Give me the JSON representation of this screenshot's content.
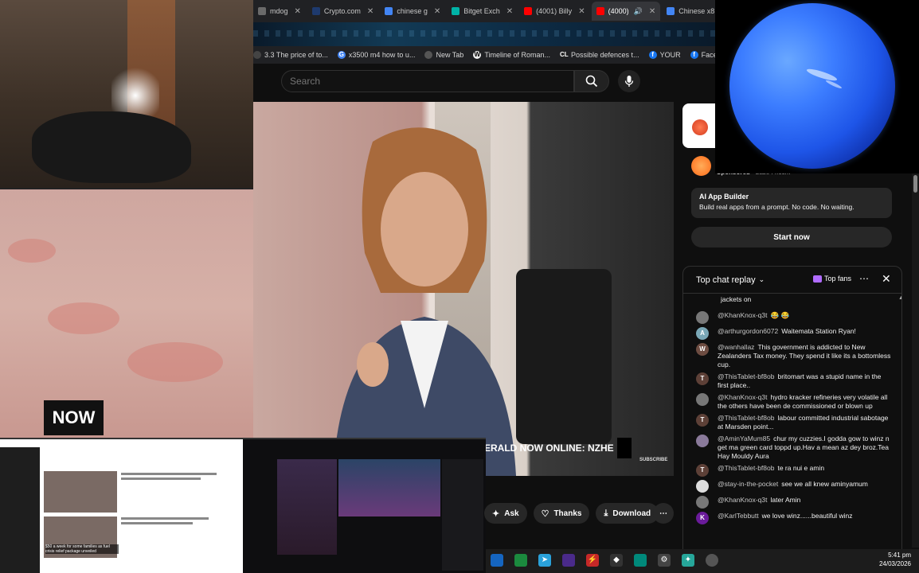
{
  "browser": {
    "tabs": [
      {
        "label": "mdog",
        "color": "#6a6a6a",
        "active": false
      },
      {
        "label": "Crypto.com",
        "color": "#1e3a6e",
        "active": false
      },
      {
        "label": "chinese g",
        "color": "#4285f4",
        "active": false
      },
      {
        "label": "Bitget Exch",
        "color": "#00b3a7",
        "active": false
      },
      {
        "label": "(4001) Billy",
        "color": "#ff0000",
        "active": false
      },
      {
        "label": "(4000)",
        "color": "#ff0000",
        "active": true
      },
      {
        "label": "Chinese x8",
        "color": "#4285f4",
        "active": false
      }
    ],
    "bookmarks": [
      {
        "label": "3.3 The price of to...",
        "icon": "",
        "color": "#444"
      },
      {
        "label": "x3500 m4 how to u...",
        "icon": "G",
        "color": "#4285f4"
      },
      {
        "label": "New Tab",
        "icon": "",
        "color": "#555"
      },
      {
        "label": "Timeline of Roman...",
        "icon": "W",
        "color": "#eee"
      },
      {
        "label": "Possible defences t...",
        "icon": "CL",
        "color": "#222"
      },
      {
        "label": "YOUR",
        "icon": "f",
        "color": "#1877f2"
      },
      {
        "label": "Facebook green",
        "icon": "f",
        "color": "#1877f2"
      }
    ]
  },
  "youtube": {
    "search_placeholder": "Search",
    "search_icon": "search-icon",
    "mic_icon": "mic-icon"
  },
  "video": {
    "channel_logo": "NOW",
    "ticker": "ERALD NOW ONLINE: NZHE",
    "watermark": "SUBSCRIBE",
    "actions": [
      {
        "label": "Ask",
        "icon": "sparkle-icon"
      },
      {
        "label": "Thanks",
        "icon": "thanks-icon"
      },
      {
        "label": "Download",
        "icon": "download-icon"
      }
    ]
  },
  "ad": {
    "sponsored": "Sponsored",
    "sponsor_domain": "base44.com",
    "title": "AI App Builder",
    "description": "Build real apps from a prompt. No code. No waiting.",
    "cta": "Start now"
  },
  "chat": {
    "title": "Top chat replay",
    "top_fans": "Top fans",
    "messages": [
      {
        "author": "",
        "text": "jackets on",
        "avatar_color": "transparent",
        "avatar_letter": ""
      },
      {
        "author": "@KhanKnox-q3t",
        "text": "😂 😂",
        "avatar_color": "#777",
        "avatar_letter": ""
      },
      {
        "author": "@arthurgordon6072",
        "text": "Waitemata Station Ryan!",
        "avatar_color": "#7aa7b6",
        "avatar_letter": "A"
      },
      {
        "author": "@wanhallaz",
        "text": "This government is addicted to New Zealanders Tax money. They spend it like its a bottomless cup.",
        "avatar_color": "#6d4c41",
        "avatar_letter": "W"
      },
      {
        "author": "@ThisTablet-bf8ob",
        "text": "britomart was a stupid name in the first place..",
        "avatar_color": "#5d4037",
        "avatar_letter": "T"
      },
      {
        "author": "@KhanKnox-q3t",
        "text": "hydro kracker refineries very volatile all the others have been de commissioned or blown up",
        "avatar_color": "#777",
        "avatar_letter": ""
      },
      {
        "author": "@ThisTablet-bf8ob",
        "text": "labour committed industrial sabotage at Marsden point...",
        "avatar_color": "#5d4037",
        "avatar_letter": "T"
      },
      {
        "author": "@AminYaMum85",
        "text": "chur my cuzzies.I godda gow to winz n get ma green card toppd up.Hav a mean az dey broz.Tea Hay Mouldy Aura",
        "avatar_color": "#8a7a9a",
        "avatar_letter": ""
      },
      {
        "author": "@ThisTablet-bf8ob",
        "text": "te ra nui e amin",
        "avatar_color": "#5d4037",
        "avatar_letter": "T"
      },
      {
        "author": "@stay-in-the-pocket",
        "text": "see we all knew aminyamum",
        "avatar_color": "#ddd",
        "avatar_letter": ""
      },
      {
        "author": "@KhanKnox-q3t",
        "text": "later Amin",
        "avatar_color": "#777",
        "avatar_letter": ""
      },
      {
        "author": "@KarlTebbutt",
        "text": "we love winz......beautiful winz",
        "avatar_color": "#6a1b9a",
        "avatar_letter": "K"
      }
    ]
  },
  "pip": {
    "caption": "$50 a week for some families as fuel crisis relief package unveiled"
  },
  "taskbar": {
    "time": "5:41 pm",
    "date": "24/03/2026"
  }
}
